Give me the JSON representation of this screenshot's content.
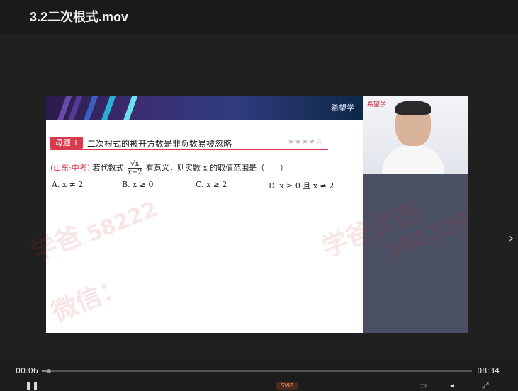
{
  "window": {
    "title": "3.2二次根式.mov"
  },
  "slide": {
    "tag": "母题 1",
    "topic": "二次根式的被开方数是非负数易被忽略",
    "stars": "★★★★☆",
    "source": "(山东·中考)",
    "question_before": "若代数式",
    "fraction_numerator": "√x",
    "fraction_denominator": "x−2",
    "question_after": "有意义，则实数 x 的取值范围是（　　）",
    "options": [
      "A. x ≠ 2",
      "B. x ≥ 0",
      "C. x ≥ 2",
      "D. x ≥ 0 且 x ≠ 2"
    ],
    "brand": "希望学"
  },
  "pip": {
    "brand": "希望学"
  },
  "watermarks": [
    "学爸",
    "58222",
    "微信：",
    "学爸优选",
    "582229"
  ],
  "player": {
    "current_time": "00:06",
    "duration": "08:34",
    "progress": 0.012,
    "pill_label": "SVIP",
    "next_icon": "chevron-right-icon"
  }
}
